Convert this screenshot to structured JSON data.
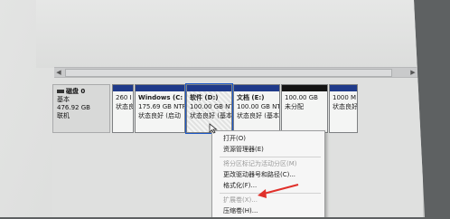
{
  "disk": {
    "name": "磁盘 0",
    "type": "基本",
    "size": "476.92 GB",
    "status": "联机"
  },
  "partitions": [
    {
      "title": "",
      "size": "260 I",
      "status": "状态良",
      "bar": "blue"
    },
    {
      "title": "Windows (C:",
      "size": "175.69 GB NTF",
      "status": "状态良好 (启动",
      "bar": "blue"
    },
    {
      "title": "软件 (D:)",
      "size": "100.00 GB NTF",
      "status": "状态良好 (基本",
      "bar": "blue"
    },
    {
      "title": "文档 (E:)",
      "size": "100.00 GB NTF",
      "status": "状态良好 (基本",
      "bar": "blue"
    },
    {
      "title": "",
      "size": "100.00 GB",
      "status": "未分配",
      "bar": "black"
    },
    {
      "title": "",
      "size": "1000 M",
      "status": "状态良好",
      "bar": "blue"
    }
  ],
  "context_menu": {
    "items": [
      {
        "label": "打开(O)",
        "disabled": false
      },
      {
        "label": "资源管理器(E)",
        "disabled": false
      },
      {
        "label": "将分区标记为活动分区(M)",
        "disabled": true
      },
      {
        "label": "更改驱动器号和路径(C)...",
        "disabled": false
      },
      {
        "label": "格式化(F)...",
        "disabled": false
      },
      {
        "label": "扩展卷(X)...",
        "disabled": true
      },
      {
        "label": "压缩卷(H)...",
        "disabled": false
      }
    ]
  },
  "colors": {
    "primary_partition_bar": "#1f3a8a",
    "unallocated_bar": "#141414",
    "annotation_arrow": "#e0302a"
  }
}
